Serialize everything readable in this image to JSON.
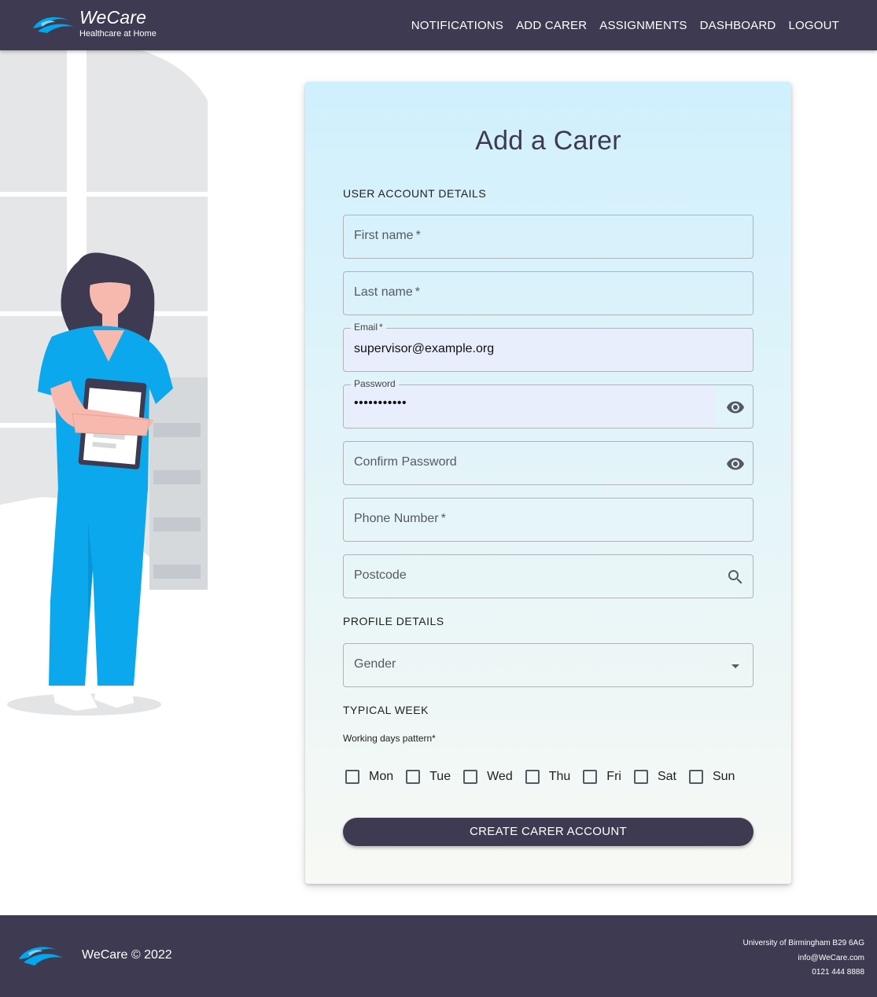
{
  "header": {
    "brand_name": "WeCare",
    "brand_tagline": "Healthcare at Home",
    "nav": [
      {
        "label": "NOTIFICATIONS"
      },
      {
        "label": "ADD CARER"
      },
      {
        "label": "ASSIGNMENTS"
      },
      {
        "label": "DASHBOARD"
      },
      {
        "label": "LOGOUT"
      }
    ]
  },
  "form": {
    "title": "Add a Carer",
    "section_account": "USER ACCOUNT DETAILS",
    "first_name": {
      "label": "First name",
      "required_mark": "*",
      "value": ""
    },
    "last_name": {
      "label": "Last name",
      "required_mark": "*",
      "value": ""
    },
    "email": {
      "label": "Email",
      "required_mark": "*",
      "value": "supervisor@example.org"
    },
    "password": {
      "label": "Password",
      "masked_value": "•••••••••••",
      "icon": "eye-icon"
    },
    "confirm_password": {
      "label": "Confirm Password",
      "icon": "eye-icon"
    },
    "phone": {
      "label": "Phone Number",
      "required_mark": "*",
      "value": ""
    },
    "postcode": {
      "label": "Postcode",
      "icon": "search-icon"
    },
    "section_profile": "PROFILE DETAILS",
    "gender": {
      "label": "Gender",
      "icon": "dropdown-arrow-icon"
    },
    "section_week": "TYPICAL WEEK",
    "working_days_label": "Working days pattern*",
    "days": [
      {
        "label": "Mon",
        "checked": false
      },
      {
        "label": "Tue",
        "checked": false
      },
      {
        "label": "Wed",
        "checked": false
      },
      {
        "label": "Thu",
        "checked": false
      },
      {
        "label": "Fri",
        "checked": false
      },
      {
        "label": "Sat",
        "checked": false
      },
      {
        "label": "Sun",
        "checked": false
      }
    ],
    "submit_label": "CREATE CARER ACCOUNT"
  },
  "footer": {
    "copyright": "WeCare © 2022",
    "address": "University of Birmingham B29 6AG",
    "email": "info@WeCare.com",
    "phone": "0121 444 8888"
  },
  "colors": {
    "brand_dark": "#3d3a51",
    "brand_blue": "#00a8f0",
    "scrubs_blue": "#0ca8ee",
    "card_top": "#d0f0fd",
    "card_bottom": "#f7f9f4"
  }
}
